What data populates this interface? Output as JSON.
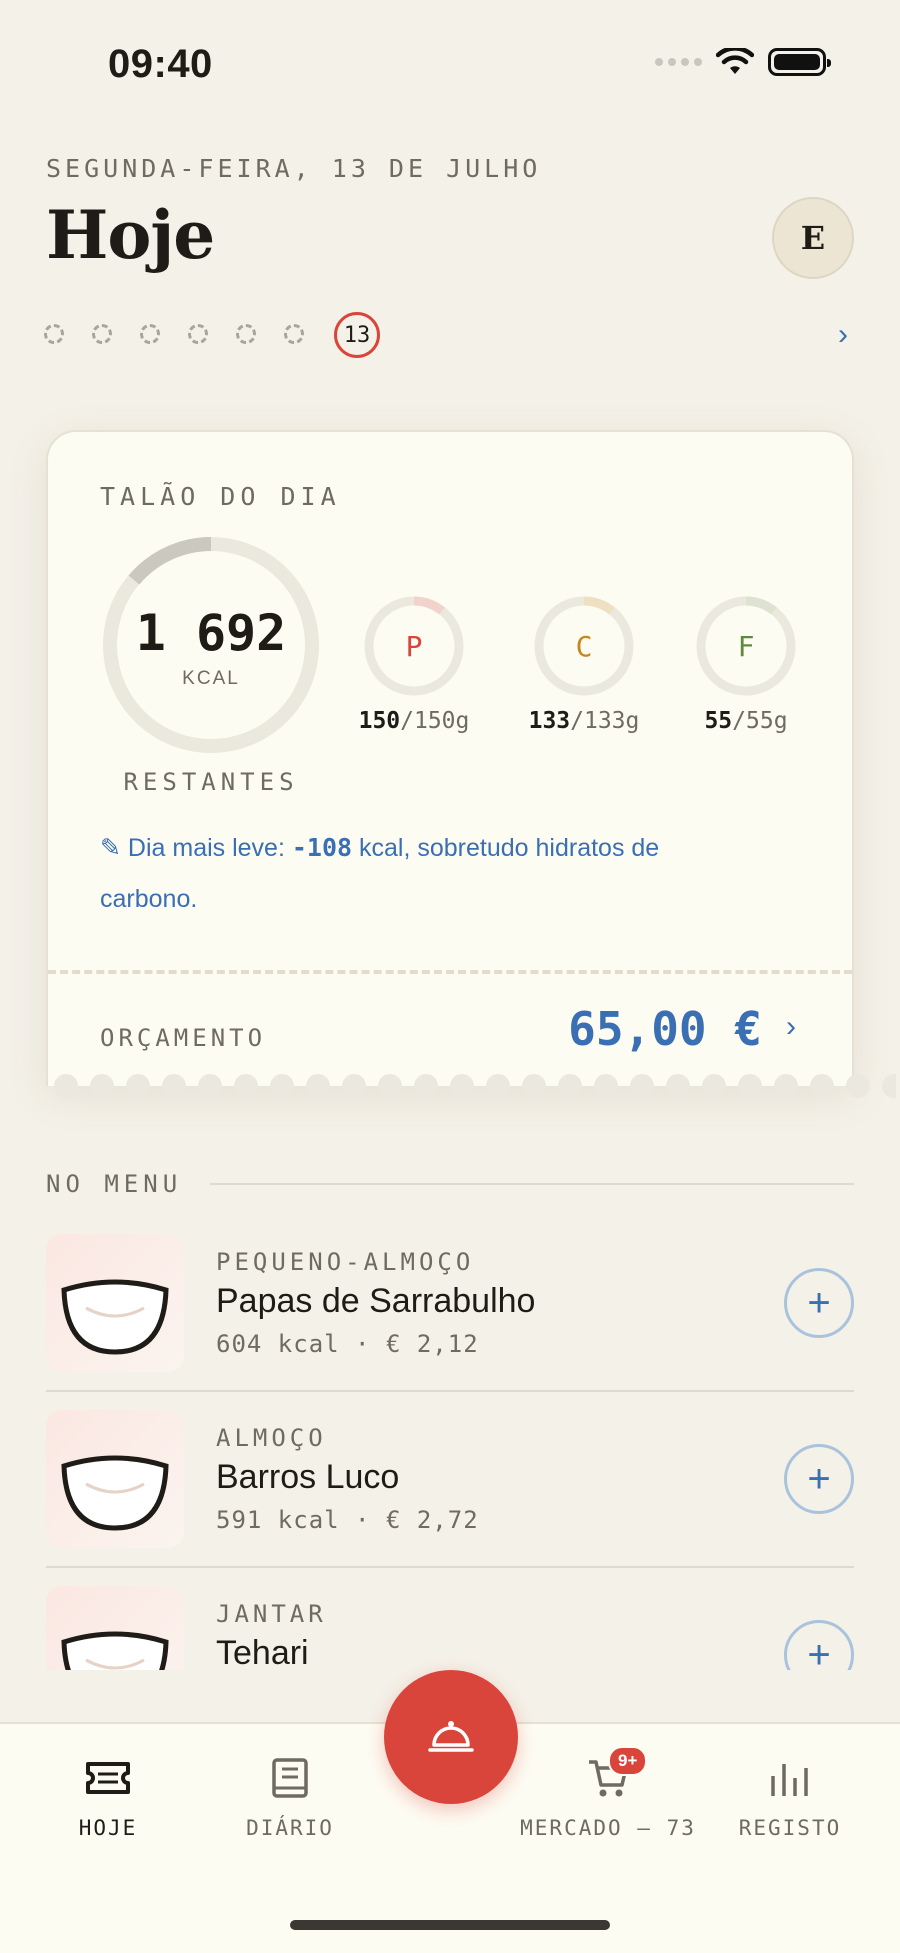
{
  "status": {
    "time": "09:40"
  },
  "header": {
    "date": "SEGUNDA-FEIRA, 13 DE JULHO",
    "title": "Hoje",
    "avatar_initial": "E"
  },
  "week": {
    "current_day": "13",
    "next": "›"
  },
  "card": {
    "title": "TALÃO DO DIA",
    "kcal_value": "1 692",
    "kcal_unit": "KCAL",
    "kcal_remaining_label": "RESTANTES",
    "macros": [
      {
        "letter": "P",
        "current": "150",
        "target": "/150g",
        "color": "#d9453b",
        "ring": "#f1d3cc"
      },
      {
        "letter": "C",
        "current": "133",
        "target": "/133g",
        "color": "#c8871e",
        "ring": "#efe0c4"
      },
      {
        "letter": "F",
        "current": "55",
        "target": "/55g",
        "color": "#5f8a3c",
        "ring": "#dde3d0"
      }
    ],
    "hint": {
      "icon": "✎",
      "prefix": "Dia mais leve: ",
      "value": "-108",
      "suffix": " kcal, sobretudo hidratos de carbono."
    },
    "budget_label": "ORÇAMENTO",
    "budget_value": "65,00 €",
    "budget_chevron": "›"
  },
  "menu": {
    "section_title": "NO MENU",
    "meals": [
      {
        "category": "PEQUENO-ALMOÇO",
        "name": "Papas de Sarrabulho",
        "meta": "604 kcal · € 2,12",
        "add": "+"
      },
      {
        "category": "ALMOÇO",
        "name": "Barros Luco",
        "meta": "591 kcal · € 2,72",
        "add": "+"
      },
      {
        "category": "JANTAR",
        "name": "Tehari",
        "meta": "",
        "add": "+"
      }
    ]
  },
  "tabs": [
    {
      "label": "HOJE",
      "icon": "ticket-icon"
    },
    {
      "label": "DIÁRIO",
      "icon": "book-icon"
    },
    {
      "label": "MERCADO — 73",
      "icon": "cart-icon",
      "badge": "9+"
    },
    {
      "label": "REGISTO",
      "icon": "bar-chart-icon"
    }
  ],
  "colors": {
    "accent_red": "#d9453b",
    "accent_blue": "#3a6fb3",
    "background": "#f4f1e8",
    "card": "#fdfcf3"
  }
}
